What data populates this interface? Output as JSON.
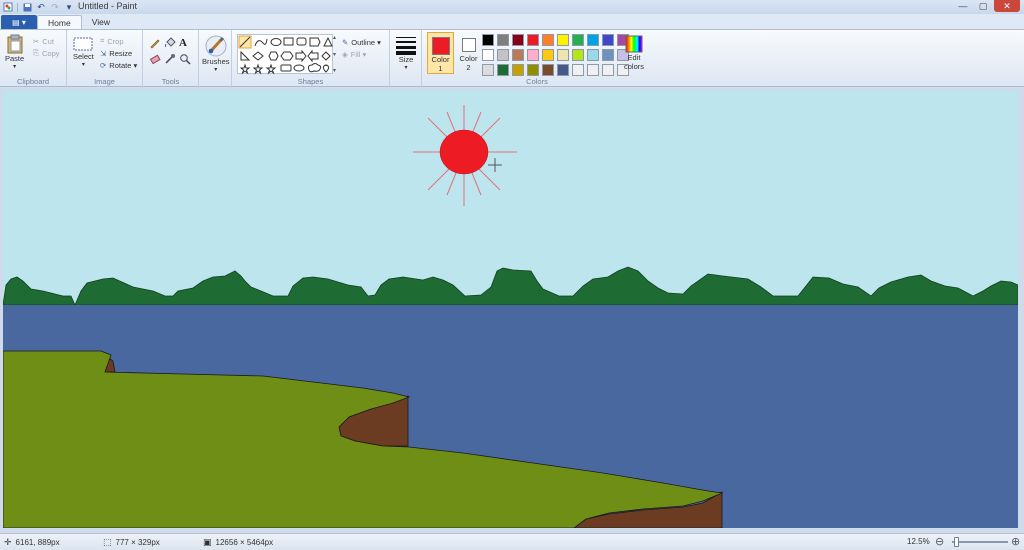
{
  "window": {
    "title": "Untitled - Paint"
  },
  "tabs": {
    "file": "▤ ▾",
    "home": "Home",
    "view": "View"
  },
  "clipboard": {
    "label": "Clipboard",
    "paste": "Paste",
    "cut": "Cut",
    "copy": "Copy"
  },
  "image": {
    "label": "Image",
    "select": "Select",
    "crop": "Crop",
    "resize": "Resize",
    "rotate": "Rotate ▾"
  },
  "tools": {
    "label": "Tools",
    "text_tool": "A"
  },
  "brushes": {
    "label": "Brushes"
  },
  "shapes": {
    "label": "Shapes",
    "outline": "Outline ▾",
    "fill": "Fill ▾"
  },
  "size": {
    "label": "Size"
  },
  "colors": {
    "label": "Colors",
    "color1_line1": "Color",
    "color1_line2": "1",
    "color2_line1": "Color",
    "color2_line2": "2",
    "edit_line1": "Edit",
    "edit_line2": "colors",
    "color1_value": "#ed1c24",
    "color2_value": "#ffffff",
    "palette": [
      "#000000",
      "#7f7f7f",
      "#880015",
      "#ed1c24",
      "#ff7f27",
      "#fff200",
      "#22b14c",
      "#00a2e8",
      "#3f48cc",
      "#a349a4",
      "#ffffff",
      "#c3c3c3",
      "#b97a57",
      "#ffaec9",
      "#ffc90e",
      "#efe4b0",
      "#b5e61d",
      "#99d9ea",
      "#7092be",
      "#c8bfe7",
      "#dcdcdc",
      "#1e6b34",
      "#c4a000",
      "#8f8f00",
      "#7a4a2a",
      "#465a8a",
      "#f0f0f0",
      "#f0f0f0",
      "#f0f0f0",
      "#f0f0f0"
    ]
  },
  "status": {
    "cursor_pos": "6161, 889px",
    "selection_size": "777 × 329px",
    "image_size": "12656 × 5464px",
    "zoom": "12.5%"
  },
  "scene": {
    "sky": "#bde5ee",
    "sun": "#ed1c24",
    "sun_rays": "#e2707a",
    "trees": "#1e6b34",
    "water": "#4a68a0",
    "grass": "#6f8e16",
    "cliff": "#6b3c22"
  }
}
